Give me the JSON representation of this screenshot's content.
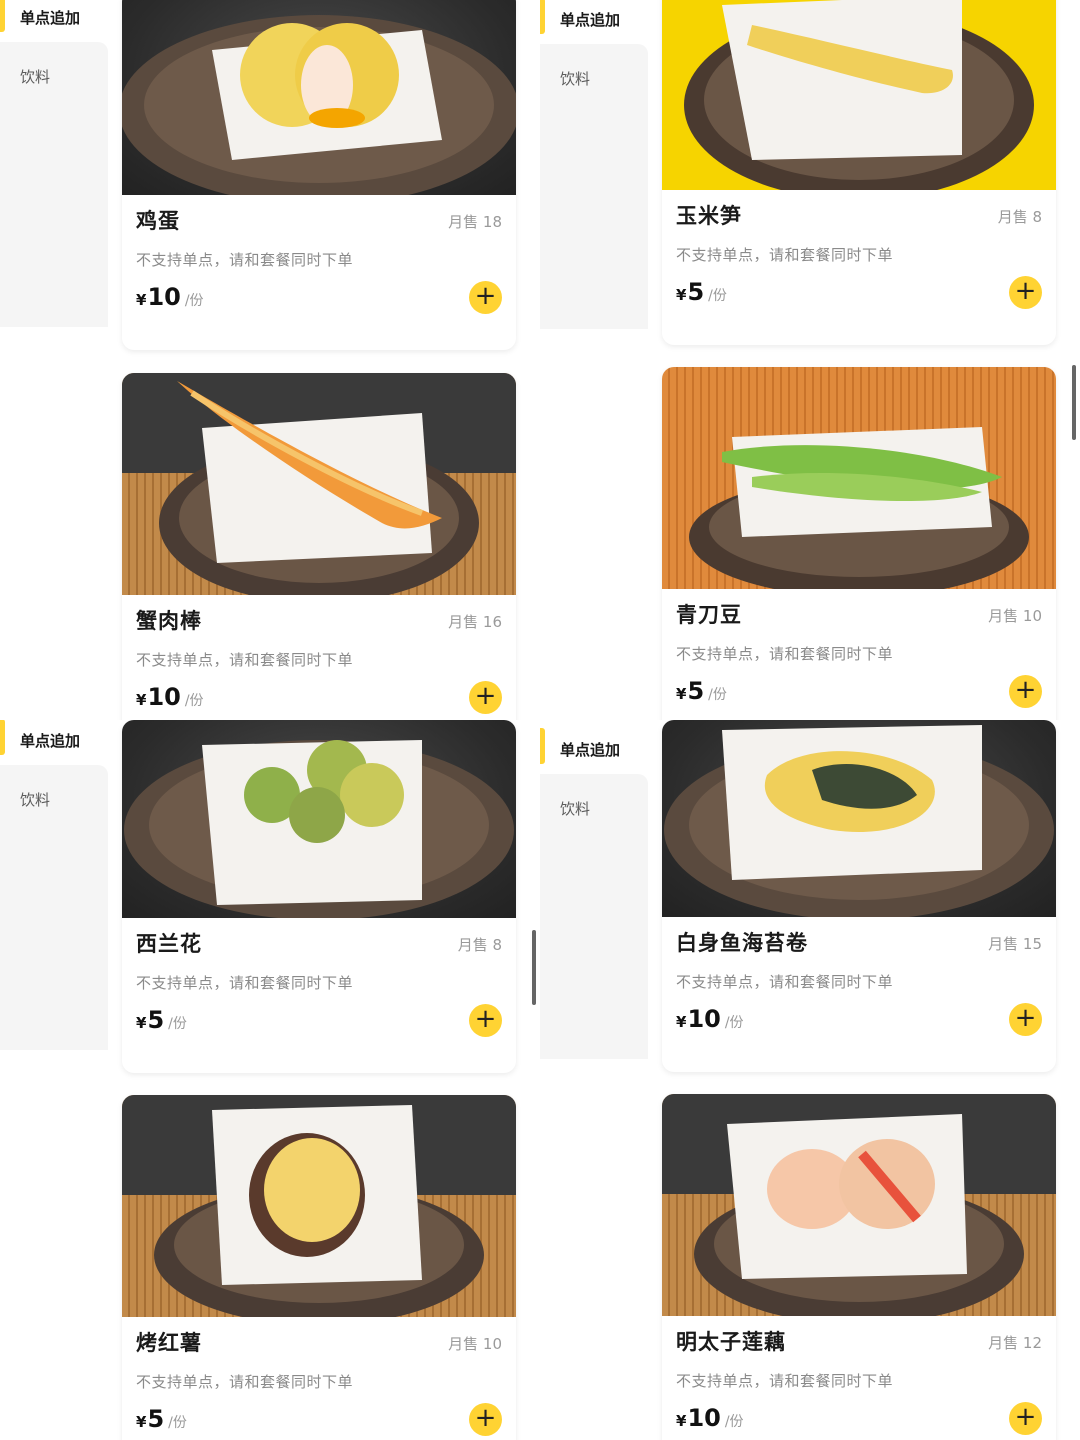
{
  "sidebar": {
    "active_label": "单点追加",
    "inactive_label": "饮料"
  },
  "colors": {
    "accent": "#ffd333",
    "sidebar_bg": "#f5f5f5",
    "muted_text": "#9a9a9a"
  },
  "icons": {
    "add": "plus-icon"
  },
  "items": [
    {
      "name": "鸡蛋",
      "sold": "月售 18",
      "note": "不支持单点，请和套餐同时下单",
      "currency": "¥",
      "price": "10",
      "unit": "/份",
      "add": "+"
    },
    {
      "name": "玉米笋",
      "sold": "月售 8",
      "note": "不支持单点，请和套餐同时下单",
      "currency": "¥",
      "price": "5",
      "unit": "/份",
      "add": "+"
    },
    {
      "name": "蟹肉棒",
      "sold": "月售 16",
      "note": "不支持单点，请和套餐同时下单",
      "currency": "¥",
      "price": "10",
      "unit": "/份",
      "add": "+"
    },
    {
      "name": "青刀豆",
      "sold": "月售 10",
      "note": "不支持单点，请和套餐同时下单",
      "currency": "¥",
      "price": "5",
      "unit": "/份",
      "add": "+"
    },
    {
      "name": "西兰花",
      "sold": "月售 8",
      "note": "不支持单点，请和套餐同时下单",
      "currency": "¥",
      "price": "5",
      "unit": "/份",
      "add": "+"
    },
    {
      "name": "白身鱼海苔卷",
      "sold": "月售 15",
      "note": "不支持单点，请和套餐同时下单",
      "currency": "¥",
      "price": "10",
      "unit": "/份",
      "add": "+"
    },
    {
      "name": "烤红薯",
      "sold": "月售 10",
      "note": "不支持单点，请和套餐同时下单",
      "currency": "¥",
      "price": "5",
      "unit": "/份",
      "add": "+"
    },
    {
      "name": "明太子莲藕",
      "sold": "月售 12",
      "note": "不支持单点，请和套餐同时下单",
      "currency": "¥",
      "price": "10",
      "unit": "/份",
      "add": "+"
    }
  ]
}
